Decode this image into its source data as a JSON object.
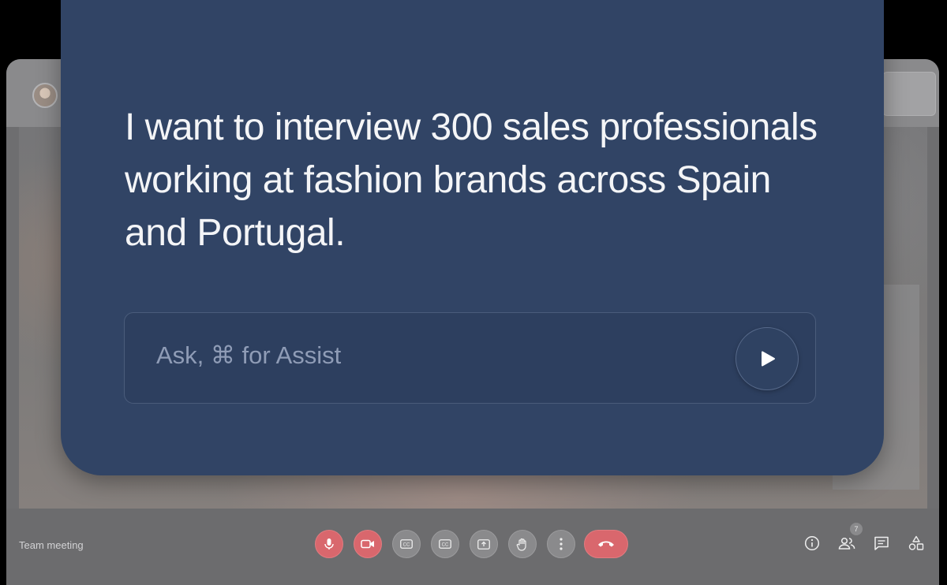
{
  "meeting": {
    "title": "Team meeting",
    "participant_count": "7"
  },
  "assistant_card": {
    "prompt_text": "I want to interview 300 sales professionals working at fashion brands across Spain and Portugal.",
    "input_placeholder": "Ask, ⌘ for Assist",
    "input_value": ""
  },
  "controls": [
    {
      "name": "microphone",
      "icon": "mic-icon",
      "state": "muted"
    },
    {
      "name": "camera",
      "icon": "video-camera-icon",
      "state": "off"
    },
    {
      "name": "captions",
      "icon": "cc-icon"
    },
    {
      "name": "captions-secondary",
      "icon": "cc-icon"
    },
    {
      "name": "present",
      "icon": "present-screen-icon"
    },
    {
      "name": "raise-hand",
      "icon": "hand-icon"
    },
    {
      "name": "more",
      "icon": "more-vertical-icon"
    },
    {
      "name": "end-call",
      "icon": "phone-hangup-icon"
    }
  ],
  "right_icons": [
    "info-icon",
    "people-icon",
    "chat-icon",
    "activities-icon"
  ],
  "colors": {
    "card_bg": "#314465",
    "danger": "#d9676d",
    "muted_text": "#8f9cb6"
  }
}
